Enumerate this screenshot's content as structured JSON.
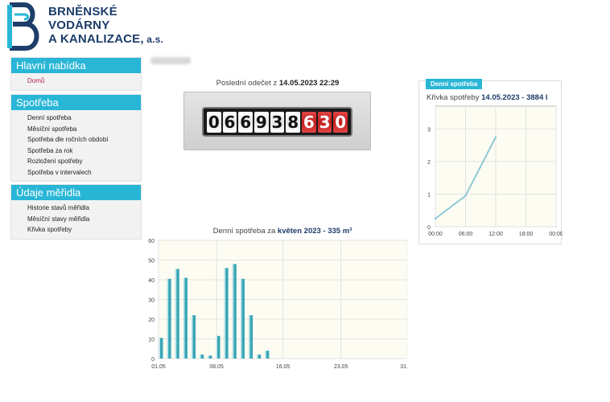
{
  "logo": {
    "line1": "BRNĚNSKÉ",
    "line2": "VODÁRNY",
    "line3": "A KANALIZACE,",
    "suffix": " a.s."
  },
  "menus": [
    {
      "title": "Hlavní nabídka",
      "items": [
        "Domů"
      ],
      "active": 0
    },
    {
      "title": "Spotřeba",
      "items": [
        "Denní spotřeba",
        "Měsíční spotřeba",
        "Spotřeba dle ročních období",
        "Spotřeba za rok",
        "Rozložení spotřeby",
        "Spotřeba v intervalech"
      ]
    },
    {
      "title": "Údaje měřidla",
      "items": [
        "Historie stavů měřidla",
        "Měsíční stavy měřidla",
        "Křivka spotřeby"
      ]
    }
  ],
  "meter": {
    "caption_prefix": "Poslední odečet z ",
    "caption_date": "14.05.2023 22:29",
    "black_digits": [
      "0",
      "6",
      "6",
      "9",
      "3",
      "8"
    ],
    "red_digits": [
      "6",
      "3",
      "0"
    ]
  },
  "daily_panel": {
    "tab": "Denní spotřeba",
    "title_prefix": "Křivka spotřeby ",
    "title_bold": "14.05.2023 - 3884 l"
  },
  "monthly_panel": {
    "title_prefix": "Denní spotřeba za ",
    "title_bold": "květen 2023 - 335 m³"
  },
  "colors": {
    "accent": "#29b6d6",
    "brand": "#1d3d6b",
    "bar": "#3aa6b6",
    "chart_bg": "#fdfcf2",
    "line": "#8fc9d8"
  },
  "chart_data": [
    {
      "type": "line",
      "x_ticks": [
        "00:00",
        "06:00",
        "12:00",
        "18:00",
        "00:00"
      ],
      "x": [
        "00:00",
        "06:00",
        "12:00"
      ],
      "y": [
        0.25,
        0.95,
        2.75
      ],
      "y_ticks": [
        "0",
        "1",
        "2",
        "3"
      ],
      "ylim": [
        0,
        3.7
      ],
      "grid": true
    },
    {
      "type": "bar",
      "x_ticks": [
        "01.05",
        "08.05",
        "16.05",
        "23.05",
        "31.05"
      ],
      "y_ticks": [
        "0",
        "10",
        "20",
        "30",
        "40",
        "50",
        "60"
      ],
      "ylim": [
        0,
        60
      ],
      "days": [
        1,
        2,
        3,
        4,
        5,
        6,
        7,
        8,
        9,
        10,
        11,
        12,
        13,
        14
      ],
      "values": [
        10.5,
        40.5,
        45.5,
        41,
        22,
        2,
        1.5,
        11.5,
        46,
        48,
        40.5,
        22,
        2,
        4
      ],
      "grid": true
    }
  ]
}
